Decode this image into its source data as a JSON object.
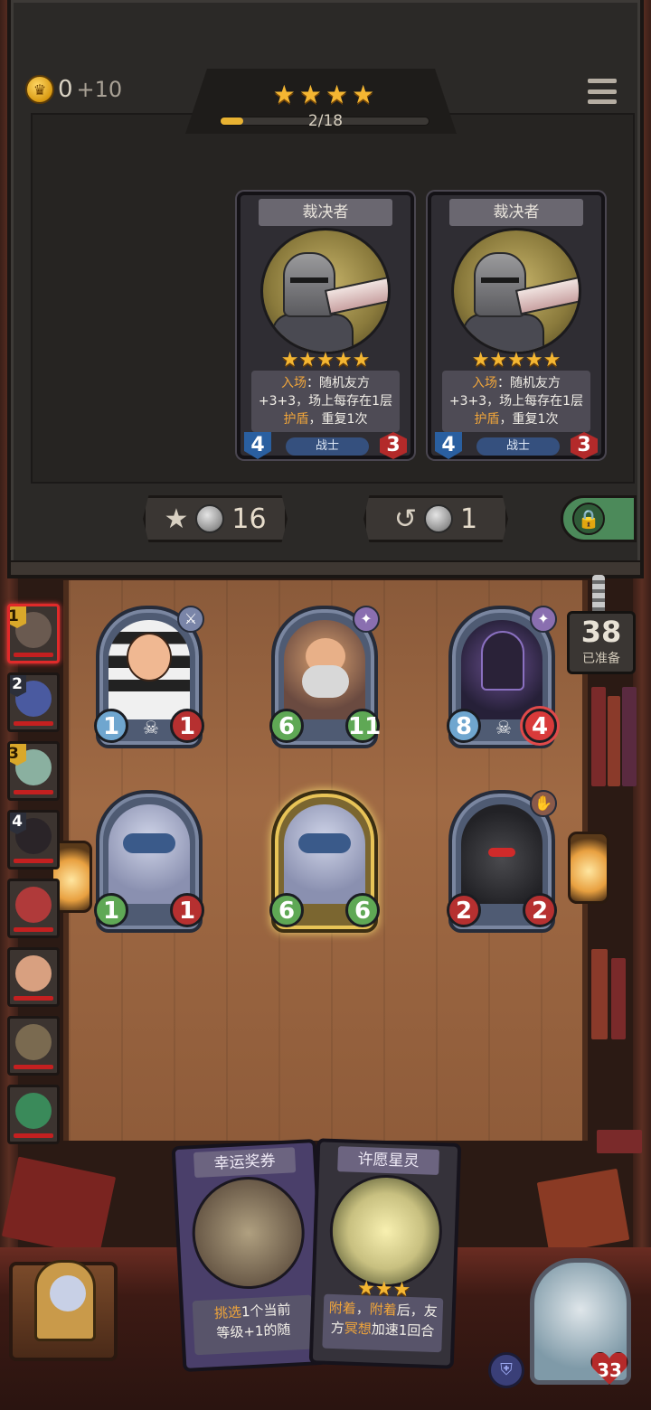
{
  "shop": {
    "gold": "0",
    "gold_income": "+10",
    "tier_stars": "★★★★",
    "xp_text": "2/18",
    "xp_progress": 0.11,
    "cards": [
      {
        "name": "裁决者",
        "stars": "★★★★★",
        "text_line1_kw": "入场",
        "text_line1": "：随机友方",
        "text_line2": "+3+3，场上每存在1层",
        "text_line3_kw": "护盾",
        "text_line3": "，重复1次",
        "attack": "4",
        "health": "3",
        "tribe": "战士"
      },
      {
        "name": "裁决者",
        "stars": "★★★★★",
        "text_line1_kw": "入场",
        "text_line1": "：随机友方",
        "text_line2": "+3+3，场上每存在1层",
        "text_line3_kw": "护盾",
        "text_line3": "，重复1次",
        "attack": "4",
        "health": "3",
        "tribe": "战士"
      }
    ],
    "upgrade_cost": "16",
    "refresh_cost": "1"
  },
  "ready": {
    "count": "38",
    "label": "已准备"
  },
  "board": {
    "minions": [
      {
        "attack": "1",
        "health": "1",
        "badge": "sword-icon",
        "skull": true
      },
      {
        "attack": "6",
        "health": "11",
        "badge": "star-icon",
        "skull": false,
        "buffed": true
      },
      {
        "attack": "8",
        "health": "4",
        "badge": "star-icon",
        "skull": true
      },
      {
        "attack": "1",
        "health": "1",
        "badge": "",
        "skull": false
      },
      {
        "attack": "6",
        "health": "6",
        "badge": "",
        "skull": false,
        "golden": true
      },
      {
        "attack": "2",
        "health": "2",
        "badge": "claw-icon",
        "skull": false
      }
    ]
  },
  "roster": [
    {
      "rank": "1"
    },
    {
      "rank": "2"
    },
    {
      "rank": "3"
    },
    {
      "rank": "4"
    },
    {
      "rank": ""
    },
    {
      "rank": ""
    },
    {
      "rank": ""
    },
    {
      "rank": ""
    }
  ],
  "hand": [
    {
      "name": "幸运奖券",
      "line1_kw": "挑选",
      "line1": "1个当前",
      "line2": "等级+1的随"
    },
    {
      "name": "许愿星灵",
      "stars": "★★★",
      "line1_kw": "附着",
      "line1_sep": "，",
      "line1_kw2": "附着",
      "line1": "后，友",
      "line2_pre": "方",
      "line2_kw": "冥想",
      "line2": "加速1回合"
    }
  ],
  "player": {
    "health": "33"
  },
  "colors": {
    "gold": "#f4b632",
    "keyword": "#f0a53a",
    "attack_blue": "#6fa6cf",
    "health_red": "#b63030",
    "buff_green": "#5fa855",
    "lock_green": "#4c8a5a"
  }
}
